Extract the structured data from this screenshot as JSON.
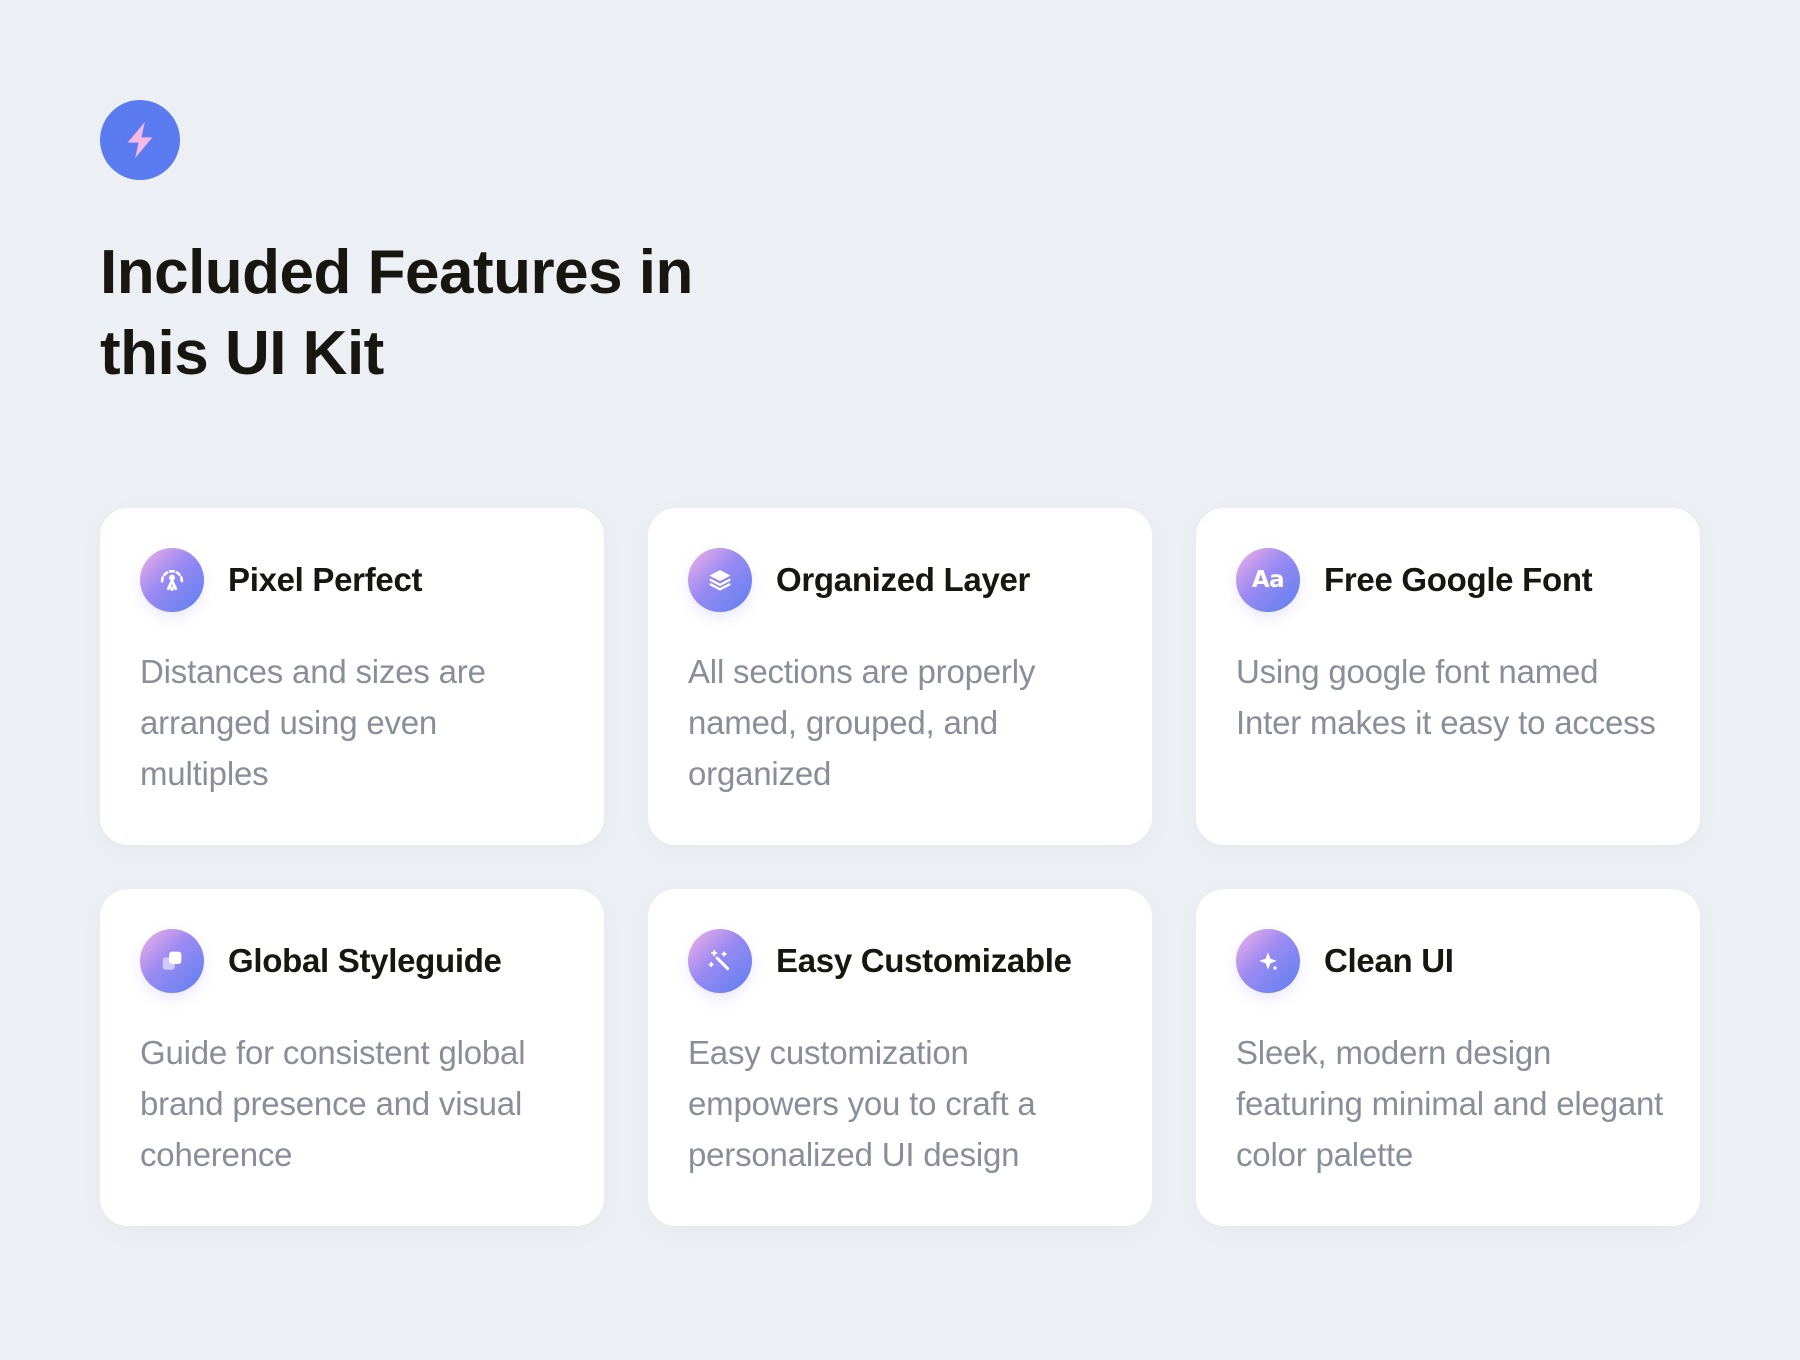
{
  "header": {
    "title_line1": "Included Features in",
    "title_line2": "this UI Kit",
    "badge_icon": "lightning-bolt-icon"
  },
  "colors": {
    "background": "#eceff3",
    "accent": "#5b7cf0",
    "bolt": "#f6b6e6",
    "title_text": "#17170f",
    "body_text": "#8a8d9a",
    "card": "#ffffff"
  },
  "features": [
    {
      "icon": "drafting-compass-icon",
      "title": "Pixel Perfect",
      "description": "Distances and sizes are arranged using even multiples"
    },
    {
      "icon": "layers-icon",
      "title": "Organized Layer",
      "description": "All sections are properly named, grouped, and organized"
    },
    {
      "icon": "typography-icon",
      "icon_text": "Aa",
      "title": "Free Google Font",
      "description": "Using google font named Inter makes it easy  to access"
    },
    {
      "icon": "styleguide-squares-icon",
      "title": "Global Styleguide",
      "description": "Guide for consistent global brand presence and visual coherence"
    },
    {
      "icon": "magic-wand-icon",
      "title": "Easy Customizable",
      "description": "Easy customization empowers you to craft a personalized UI design"
    },
    {
      "icon": "sparkle-icon",
      "title": "Clean UI",
      "description": "Sleek, modern design featuring minimal and elegant color palette"
    }
  ]
}
